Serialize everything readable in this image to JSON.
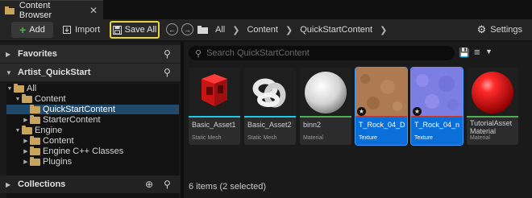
{
  "tab": {
    "title": "Content Browser",
    "close": "✕"
  },
  "toolbar": {
    "add_label": "Add",
    "import_label": "Import",
    "save_all_label": "Save All",
    "breadcrumbs": [
      "All",
      "Content",
      "QuickStartContent"
    ],
    "settings_label": "Settings"
  },
  "left": {
    "favorites_label": "Favorites",
    "project_label": "Artist_QuickStart",
    "collections_label": "Collections",
    "tree": [
      {
        "label": "All",
        "depth": 0,
        "expanded": true,
        "selected": false
      },
      {
        "label": "Content",
        "depth": 1,
        "expanded": true,
        "selected": false
      },
      {
        "label": "QuickStartContent",
        "depth": 2,
        "expanded": false,
        "selected": true
      },
      {
        "label": "StarterContent",
        "depth": 2,
        "expanded": false,
        "selected": false
      },
      {
        "label": "Engine",
        "depth": 1,
        "expanded": true,
        "selected": false
      },
      {
        "label": "Content",
        "depth": 2,
        "expanded": false,
        "selected": false
      },
      {
        "label": "Engine C++ Classes",
        "depth": 2,
        "expanded": false,
        "selected": false
      },
      {
        "label": "Plugins",
        "depth": 2,
        "expanded": false,
        "selected": false
      }
    ]
  },
  "right": {
    "search_placeholder": "Search QuickStartContent",
    "status_text": "6 items (2 selected)",
    "assets": [
      {
        "name": "Basic_Asset1",
        "type": "Static Mesh",
        "selected": false,
        "bar_color": "#1ec9e6"
      },
      {
        "name": "Basic_Asset2",
        "type": "Static Mesh",
        "selected": false,
        "bar_color": "#1ec9e6"
      },
      {
        "name": "binn2",
        "type": "Material",
        "selected": false,
        "bar_color": "#4caf50"
      },
      {
        "name": "T_Rock_04_D",
        "type": "Texture",
        "selected": true,
        "bar_color": "#c0392b"
      },
      {
        "name": "T_Rock_04_n",
        "type": "Texture",
        "selected": true,
        "bar_color": "#c0392b"
      },
      {
        "name": "TutorialAsset Material",
        "type": "Material",
        "selected": false,
        "bar_color": "#4caf50"
      }
    ]
  },
  "colors": {
    "accent": "#0a6fd8",
    "highlight_border": "#e6d34a",
    "selection_row": "#1f4a6b"
  }
}
